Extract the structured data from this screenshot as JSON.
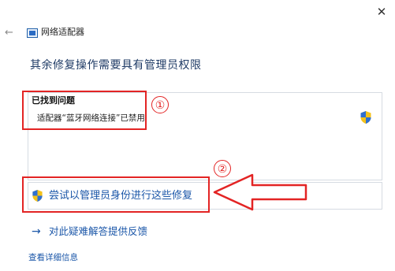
{
  "window": {
    "close_glyph": "✕",
    "back_glyph": "←",
    "title": "网络适配器",
    "title_icon": "network-adapter-icon"
  },
  "main": {
    "heading": "其余修复操作需要具有管理员权限",
    "found": {
      "title": "已找到问题",
      "item": "适配器“蓝牙网络连接”已禁用",
      "item_icon": "uac-shield-icon"
    },
    "admin_action": {
      "label": "尝试以管理员身份进行这些修复",
      "icon": "uac-shield-icon"
    },
    "feedback": {
      "arrow": "→",
      "label": "对此疑难解答提供反馈"
    },
    "details_link": "查看详细信息"
  },
  "annotations": {
    "marker_1": "①",
    "marker_2": "②",
    "color": "#e32424"
  },
  "colors": {
    "link": "#1a56a8",
    "heading": "#1f3b66",
    "panel_border": "#d6dbe2"
  }
}
